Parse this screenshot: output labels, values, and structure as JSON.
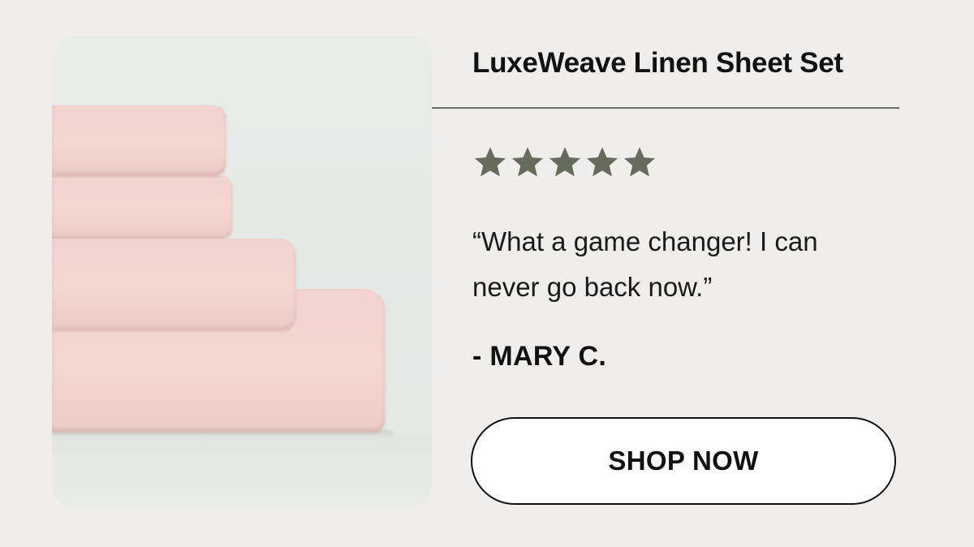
{
  "product": {
    "title": "LuxeWeave Linen Sheet Set",
    "image_alt": "Stack of folded pink linen sheets"
  },
  "review": {
    "rating": 5,
    "rating_max": 5,
    "star_color": "#676b5c",
    "quote": "“What a game changer! I can never go back now.”",
    "author": "- MARY C."
  },
  "cta": {
    "label": "SHOP NOW"
  },
  "colors": {
    "background": "#efeeec",
    "divider": "#6b6e62",
    "sheet_pink": "#f2d3cf"
  }
}
